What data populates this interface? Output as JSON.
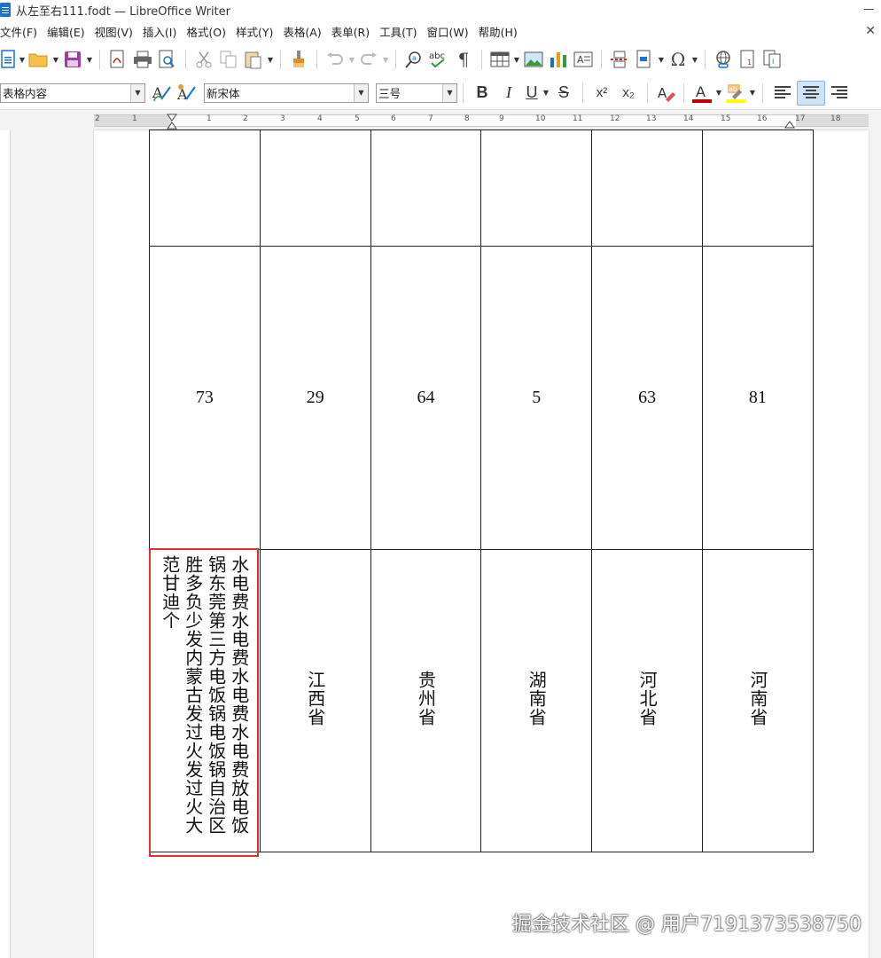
{
  "window": {
    "title": "从左至右111.fodt — LibreOffice Writer"
  },
  "menu": [
    "文件(F)",
    "编辑(E)",
    "视图(V)",
    "插入(I)",
    "格式(O)",
    "样式(Y)",
    "表格(A)",
    "表单(R)",
    "工具(T)",
    "窗口(W)",
    "帮助(H)"
  ],
  "format_bar": {
    "paragraph_style": "表格内容",
    "font_name": "新宋体",
    "font_size": "三号",
    "bold": "B",
    "italic": "I",
    "underline": "U",
    "strike": "S",
    "superscript": "x²",
    "subscript": "x₂"
  },
  "ruler": {
    "labels": [
      "2",
      "1",
      "1",
      "2",
      "3",
      "4",
      "5",
      "6",
      "7",
      "8",
      "9",
      "10",
      "11",
      "12",
      "13",
      "14",
      "15",
      "16",
      "17",
      "18"
    ]
  },
  "table": {
    "row_numbers": [
      "73",
      "29",
      "64",
      "5",
      "63",
      "81"
    ],
    "first_cell_text": "水电费水电费水电费水电费放电饭锅东莞第三方电饭锅电饭锅自治区胜多负少发内蒙古发过火发过火大范甘迪个",
    "provinces": [
      "江西省",
      "贵州省",
      "湖南省",
      "河北省",
      "河南省"
    ]
  },
  "watermark": "掘金技术社区 @ 用户7191373538750",
  "colors": {
    "font_color": "#c00000",
    "highlight": "#ffff00",
    "selection_box": "#e03030",
    "active_button": "#cfe3f7"
  },
  "icons": [
    "new-document-icon",
    "open-folder-icon",
    "save-icon",
    "export-pdf-icon",
    "print-icon",
    "print-preview-icon",
    "cut-icon",
    "copy-icon",
    "paste-icon",
    "clone-formatting-icon",
    "undo-icon",
    "redo-icon",
    "find-replace-icon",
    "spelling-icon",
    "formatting-marks-icon",
    "insert-table-icon",
    "insert-image-icon",
    "insert-chart-icon",
    "insert-textbox-icon",
    "page-break-icon",
    "insert-field-icon",
    "special-character-icon",
    "hyperlink-icon",
    "footnote-icon",
    "comment-icon"
  ]
}
